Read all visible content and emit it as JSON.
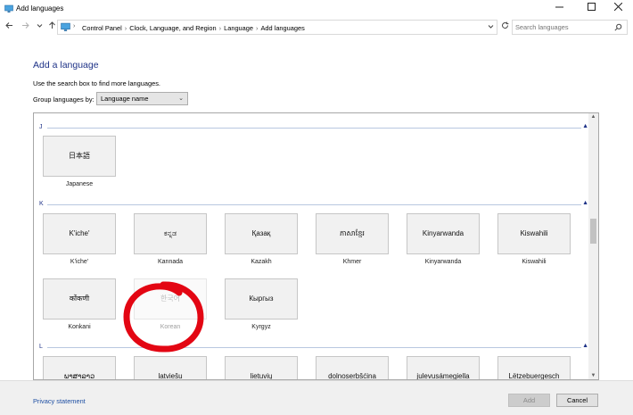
{
  "window": {
    "title": "Add languages",
    "minimize_icon": "minimize-icon",
    "maximize_icon": "maximize-icon",
    "close_icon": "close-icon"
  },
  "address_bar": {
    "crumbs": [
      "Control Panel",
      "Clock, Language, and Region",
      "Language",
      "Add languages"
    ],
    "search_placeholder": "Search languages"
  },
  "header": {
    "title": "Add a language",
    "hint": "Use the search box to find more languages.",
    "group_label": "Group languages by:",
    "group_value": "Language name"
  },
  "groups": [
    {
      "letter": "J",
      "languages": [
        {
          "native": "日本語",
          "name": "Japanese"
        }
      ]
    },
    {
      "letter": "K",
      "languages": [
        {
          "native": "K'iche'",
          "name": "K'iche'"
        },
        {
          "native": "ಕನ್ನಡ",
          "name": "Kannada"
        },
        {
          "native": "Қазақ",
          "name": "Kazakh"
        },
        {
          "native": "ភាសាខ្មែរ",
          "name": "Khmer"
        },
        {
          "native": "Kinyarwanda",
          "name": "Kinyarwanda"
        },
        {
          "native": "Kiswahili",
          "name": "Kiswahili"
        },
        {
          "native": "कोंकणी",
          "name": "Konkani"
        },
        {
          "native": "한국어",
          "name": "Korean",
          "dimmed": true
        },
        {
          "native": "Кыргыз",
          "name": "Kyrgyz"
        }
      ]
    },
    {
      "letter": "L",
      "languages": [
        {
          "native": "ພາສາລາວ",
          "name": ""
        },
        {
          "native": "latviešu",
          "name": ""
        },
        {
          "native": "lietuvių",
          "name": ""
        },
        {
          "native": "dolnoserbšćina",
          "name": ""
        },
        {
          "native": "julevusámegiella",
          "name": ""
        },
        {
          "native": "Lëtzebuergesch",
          "name": ""
        }
      ]
    }
  ],
  "footer": {
    "privacy": "Privacy statement",
    "add_label": "Add",
    "cancel_label": "Cancel"
  },
  "colors": {
    "accent": "#1e3287",
    "link": "#1e4fa3",
    "annotation": "#e30613"
  }
}
